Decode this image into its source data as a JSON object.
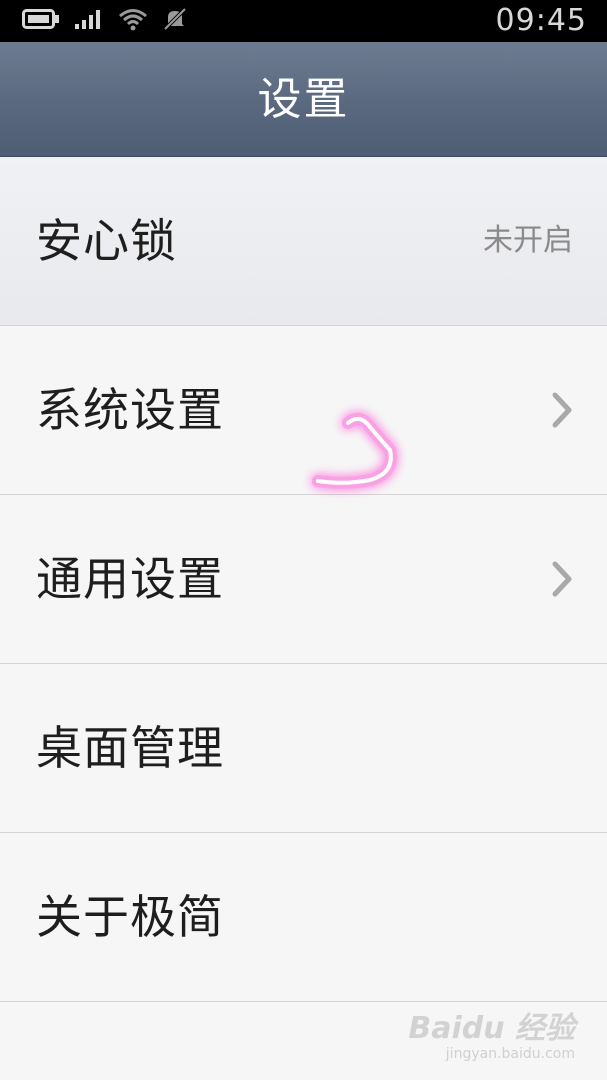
{
  "status_bar": {
    "time": "09:45",
    "icons": [
      "battery-icon",
      "signal-icon",
      "wifi-icon",
      "notification-muted-icon"
    ]
  },
  "header": {
    "title": "设置"
  },
  "settings": {
    "items": [
      {
        "label": "安心锁",
        "value": "未开启",
        "has_chevron": false
      },
      {
        "label": "系统设置",
        "value": "",
        "has_chevron": true
      },
      {
        "label": "通用设置",
        "value": "",
        "has_chevron": true
      },
      {
        "label": "桌面管理",
        "value": "",
        "has_chevron": false
      },
      {
        "label": "关于极简",
        "value": "",
        "has_chevron": false
      }
    ]
  },
  "watermark": {
    "logo": "Baidu 经验",
    "sub": "jingyan.baidu.com"
  },
  "colors": {
    "header_bg": "#5c6a81",
    "title_text": "#ffffff",
    "list_bg": "#f6f6f6",
    "divider": "#d4d4d4",
    "value_text": "#8a8a8a",
    "touch_mark": "#ff5ad6"
  }
}
